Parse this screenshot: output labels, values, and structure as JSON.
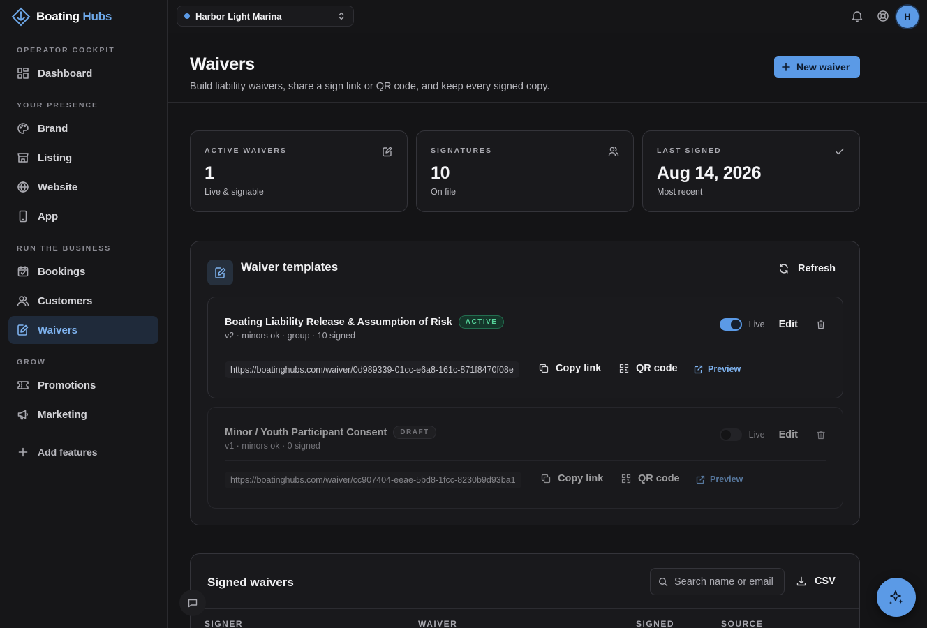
{
  "brand": {
    "name_part1": "Boating",
    "name_part2": "Hubs"
  },
  "sidebar": {
    "sections": [
      "OPERATOR COCKPIT",
      "YOUR PRESENCE",
      "RUN THE BUSINESS",
      "GROW"
    ],
    "items": [
      {
        "label": "Dashboard",
        "icon": "dashboard-icon"
      },
      {
        "label": "Brand",
        "icon": "palette-icon"
      },
      {
        "label": "Listing",
        "icon": "store-icon"
      },
      {
        "label": "Website",
        "icon": "globe-icon"
      },
      {
        "label": "App",
        "icon": "phone-icon"
      },
      {
        "label": "Bookings",
        "icon": "calendar-icon"
      },
      {
        "label": "Customers",
        "icon": "users-icon"
      },
      {
        "label": "Waivers",
        "icon": "edit-doc-icon",
        "active": true
      },
      {
        "label": "Promotions",
        "icon": "ticket-icon"
      },
      {
        "label": "Marketing",
        "icon": "megaphone-icon"
      }
    ],
    "add_features": "Add features"
  },
  "topbar": {
    "marina": "Harbor Light Marina",
    "avatar_initial": "H"
  },
  "header": {
    "title": "Waivers",
    "subtitle": "Build liability waivers, share a sign link or QR code, and keep every signed copy.",
    "new_button": "New waiver"
  },
  "stats": [
    {
      "label": "ACTIVE WAIVERS",
      "value": "1",
      "sub": "Live & signable"
    },
    {
      "label": "SIGNATURES",
      "value": "10",
      "sub": "On file"
    },
    {
      "label": "LAST SIGNED",
      "value": "Aug 14, 2026",
      "sub": "Most recent"
    }
  ],
  "templates": {
    "title": "Waiver templates",
    "refresh": "Refresh",
    "items": [
      {
        "name": "Boating Liability Release & Assumption of Risk",
        "status": "ACTIVE",
        "meta": "v2 · minors ok · group · 10 signed",
        "live": true,
        "live_label": "Live",
        "edit": "Edit",
        "url": "https://boatinghubs.com/waiver/0d989339-01cc-e6a8-161c-871f8470f08e",
        "copy": "Copy link",
        "qr": "QR code",
        "preview": "Preview"
      },
      {
        "name": "Minor / Youth Participant Consent",
        "status": "DRAFT",
        "meta": "v1 · minors ok · 0 signed",
        "live": false,
        "live_label": "Live",
        "edit": "Edit",
        "url": "https://boatinghubs.com/waiver/cc907404-eeae-5bd8-1fcc-8230b9d93ba1",
        "copy": "Copy link",
        "qr": "QR code",
        "preview": "Preview"
      }
    ]
  },
  "signed": {
    "title": "Signed waivers",
    "search_placeholder": "Search name or email",
    "csv": "CSV",
    "columns": [
      "SIGNER",
      "WAIVER",
      "SIGNED",
      "SOURCE"
    ]
  },
  "colors": {
    "accent": "#5b9ae6",
    "active_badge": "#56d39a",
    "background": "#141416"
  }
}
